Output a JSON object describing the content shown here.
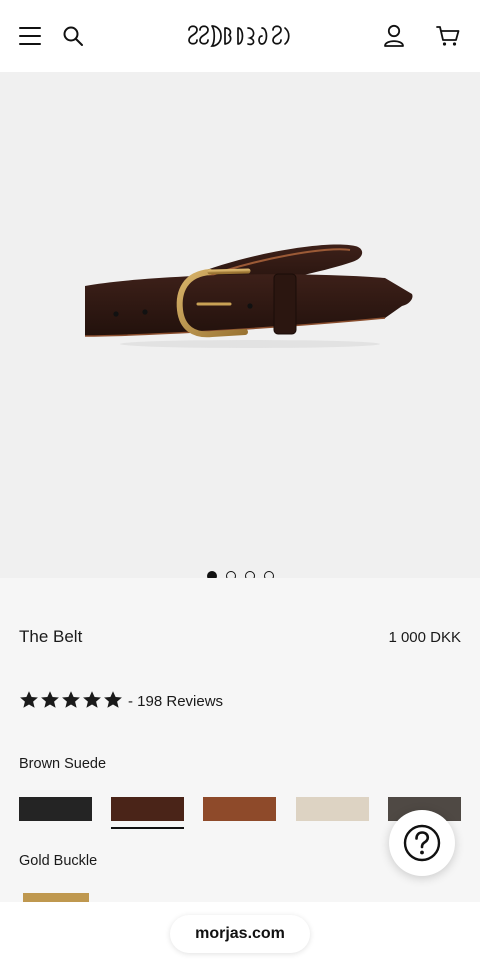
{
  "header": {
    "menu_icon": "hamburger-menu-icon",
    "search_icon": "search-icon",
    "brand": "MORJAS",
    "account_icon": "user-icon",
    "cart_icon": "cart-icon"
  },
  "gallery": {
    "total_images": 4,
    "active_index": 0,
    "image_subject": "brown suede belt with gold buckle"
  },
  "product": {
    "title": "The Belt",
    "price": "1 000 DKK",
    "rating": 5,
    "reviews_text": "- 198 Reviews",
    "selected_color_label": "Brown Suede",
    "swatches": [
      {
        "name": "black suede",
        "color": "#242424"
      },
      {
        "name": "brown suede",
        "color": "#4a2418"
      },
      {
        "name": "cognac suede",
        "color": "#8e4a2a"
      },
      {
        "name": "sand suede",
        "color": "#ddd3c3"
      },
      {
        "name": "grey suede",
        "color": "#4f4944"
      }
    ],
    "selected_swatch": 1,
    "buckle_label": "Gold Buckle",
    "buckle_color": "#bf984f"
  },
  "help": {
    "icon": "question-mark-icon"
  },
  "browser": {
    "url": "morjas.com"
  },
  "colors": {
    "header_bg": "#ffffff",
    "hero_bg": "#f0f0f0",
    "page_bg": "#f6f6f6",
    "text": "#1a1a1a"
  }
}
